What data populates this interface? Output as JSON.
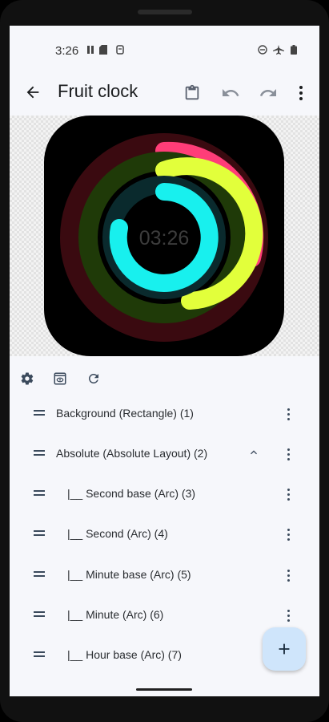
{
  "status_bar": {
    "time": "3:26"
  },
  "app_bar": {
    "title": "Fruit clock"
  },
  "preview": {
    "clock_text": "03:26",
    "rings": [
      {
        "name": "Hour",
        "color": "#ff3d78",
        "base_color": "#3a0a10"
      },
      {
        "name": "Minute",
        "color": "#e2ff3b",
        "base_color": "#1f3a08"
      },
      {
        "name": "Second",
        "color": "#18f0ee",
        "base_color": "#0a2a2d"
      }
    ]
  },
  "layers": [
    {
      "label": "Background (Rectangle) (1)",
      "expandable": false
    },
    {
      "label": "Absolute (Absolute Layout) (2)",
      "expandable": true
    },
    {
      "label": "|__  Second base (Arc) (3)",
      "expandable": false
    },
    {
      "label": "|__  Second (Arc) (4)",
      "expandable": false
    },
    {
      "label": "|__  Minute base (Arc) (5)",
      "expandable": false
    },
    {
      "label": "|__  Minute (Arc) (6)",
      "expandable": false
    },
    {
      "label": "|__  Hour base (Arc) (7)",
      "expandable": false
    }
  ],
  "icons": {
    "back": "arrow-back-icon",
    "clipboard": "clipboard-icon",
    "undo": "undo-icon",
    "redo": "redo-icon",
    "more": "more-vert-icon",
    "settings": "gear-icon",
    "preview": "preview-icon",
    "refresh": "refresh-icon",
    "add": "add-icon"
  }
}
